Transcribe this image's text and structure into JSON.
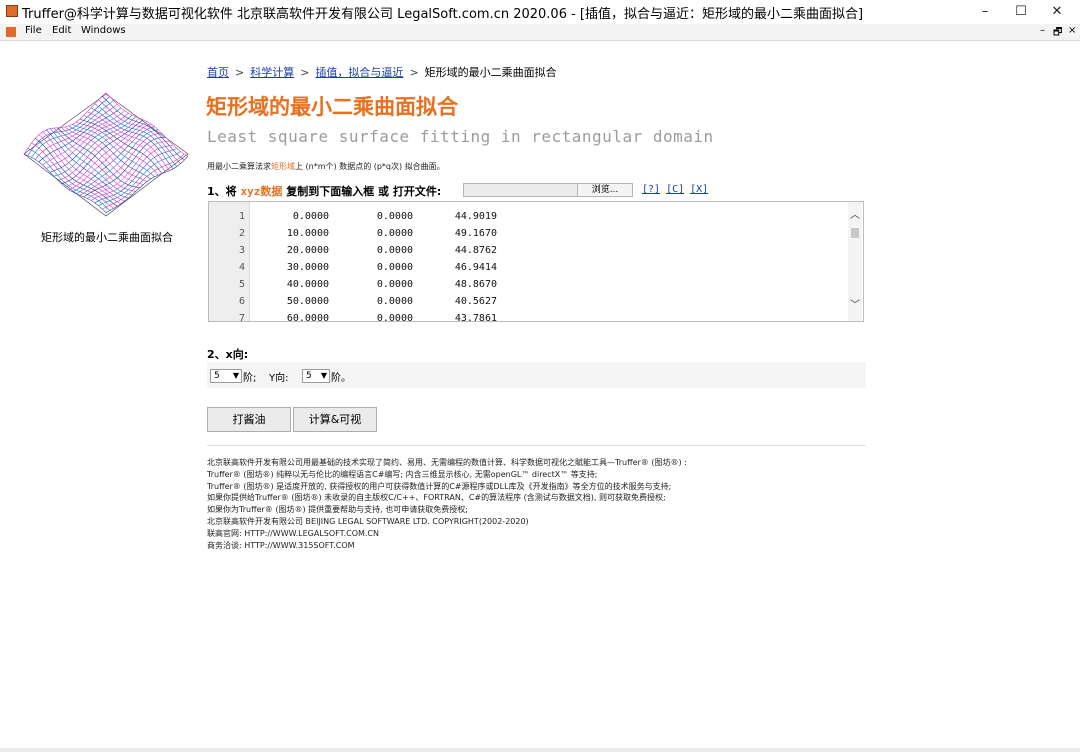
{
  "window": {
    "title": "Truffer@科学计算与数据可视化软件 北京联高软件开发有限公司 LegalSoft.com.cn 2020.06 - [插值，拟合与逼近：矩形域的最小二乘曲面拟合]",
    "minimize": "–",
    "maximize": "☐",
    "close": "✕"
  },
  "menu": {
    "items": [
      "File",
      "Edit",
      "Windows"
    ],
    "mdi_controls": [
      "–",
      "🗗",
      "×"
    ]
  },
  "sidebar": {
    "label": "矩形域的最小二乘曲面拟合"
  },
  "breadcrumb": {
    "home": "首页",
    "sep": ">",
    "sci": "科学计算",
    "interp": "插值，拟合与逼近",
    "current": "矩形域的最小二乘曲面拟合"
  },
  "page": {
    "title": "矩形域的最小二乘曲面拟合",
    "subtitle": "Least square surface fitting in rectangular domain",
    "desc_pre": "用最小二乘算法求",
    "desc_hl": "矩形域",
    "desc_post": "上 (n*m个) 数据点的 (p*q次) 拟合曲面。"
  },
  "step1": {
    "pre": "1、将",
    "keyword": "xyz数据",
    "mid": "复制到下面输入框 或 打开文件:",
    "browse": "浏览...",
    "links": [
      "[?]",
      "[C]",
      "[X]"
    ]
  },
  "data": {
    "rows": [
      {
        "n": "1",
        "x": "0.0000",
        "y": "0.0000",
        "z": "44.9019"
      },
      {
        "n": "2",
        "x": "10.0000",
        "y": "0.0000",
        "z": "49.1670"
      },
      {
        "n": "3",
        "x": "20.0000",
        "y": "0.0000",
        "z": "44.8762"
      },
      {
        "n": "4",
        "x": "30.0000",
        "y": "0.0000",
        "z": "46.9414"
      },
      {
        "n": "5",
        "x": "40.0000",
        "y": "0.0000",
        "z": "48.8670"
      },
      {
        "n": "6",
        "x": "50.0000",
        "y": "0.0000",
        "z": "40.5627"
      },
      {
        "n": "7",
        "x": "60.0000",
        "y": "0.0000",
        "z": "43.7861"
      }
    ]
  },
  "step2": {
    "label": "2、x向:",
    "x_order": "5",
    "x_suffix": "阶;",
    "y_label": "Y向:",
    "y_order": "5",
    "y_suffix": "阶。"
  },
  "buttons": {
    "soy": "打酱油",
    "compute": "计算&可视"
  },
  "footer": {
    "lines": [
      "北京联高软件开发有限公司用最基础的技术实现了简约、易用、无需编程的数值计算、科学数据可视化之賦能工具—Truffer® (图坊®) :",
      "Truffer® (图坊®) 纯粹以无与伦比的编程语言C#编写; 内含三维显示核心, 无需openGL™ directX™ 等支持;",
      "Truffer® (图坊®) 是适度开放的, 获得授权的用户可获得数值计算的C#源程序或DLL库及《开发指南》等全方位的技术服务与支持;",
      "如果你提供给Truffer® (图坊®) 未收录的自主版权C/C++、FORTRAN、C#的算法程序 (含测试与数据文档), 则可获取免费授权;",
      "如果你为Truffer® (图坊®) 提供重要帮助与支持, 也可申请获取免费授权;",
      "北京联高软件开发有限公司 BEIJING LEGAL SOFTWARE LTD. COPYRIGHT(2002-2020)",
      "联高官网: HTTP://WWW.LEGALSOFT.COM.CN",
      "商务洽谈: HTTP://WWW.315SOFT.COM"
    ]
  },
  "colors": {
    "accent": "#e8701f",
    "link": "#1a3fa8"
  }
}
